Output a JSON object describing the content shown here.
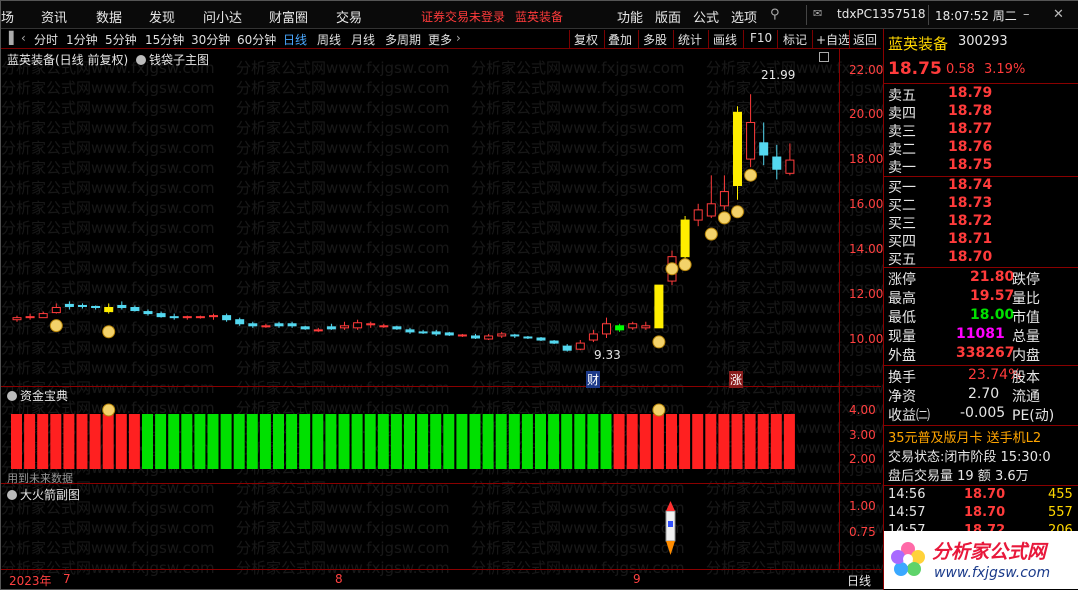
{
  "menubar": {
    "items": [
      "场",
      "资讯",
      "数据",
      "发现",
      "问小达",
      "财富圈",
      "交易"
    ],
    "warning": "证券交易未登录",
    "stock_link": "蓝英装备",
    "right_items": [
      "功能",
      "版面",
      "公式",
      "选项"
    ],
    "user": "tdxPC1357518",
    "clock": "18:07:52 周二"
  },
  "toolbar": {
    "periods": [
      "分时",
      "1分钟",
      "5分钟",
      "15分钟",
      "30分钟",
      "60分钟",
      "日线",
      "周线",
      "月线",
      "多周期",
      "更多"
    ],
    "active_period": "日线",
    "right": [
      "复权",
      "叠加",
      "多股",
      "统计",
      "画线",
      "F10",
      "标记",
      "+自选",
      "返回"
    ]
  },
  "main_panel": {
    "title": "蓝英装备(日线 前复权)",
    "indicator": "钱袋子主图",
    "high_label": "21.99",
    "low_label": "9.33",
    "flag_cai": "财",
    "flag_zhang": "涨"
  },
  "sub1": {
    "title": "资金宝典",
    "note": "用到未来数据"
  },
  "sub2": {
    "title": "大火箭副图"
  },
  "axis": {
    "main": [
      "22.00",
      "20.00",
      "18.00",
      "16.00",
      "14.00",
      "12.00",
      "10.00"
    ],
    "sub1": [
      "4.00",
      "3.00",
      "2.00"
    ],
    "sub2": [
      "1.00",
      "0.75"
    ]
  },
  "dates": {
    "year": "2023年",
    "m7": "7",
    "m8": "8",
    "m9": "9",
    "period_btn": "日线"
  },
  "quote": {
    "name": "蓝英装备",
    "code": "300293",
    "price": "18.75",
    "change": "0.58",
    "pct": "3.19%",
    "asks": [
      {
        "label": "卖五",
        "price": "18.79"
      },
      {
        "label": "卖四",
        "price": "18.78"
      },
      {
        "label": "卖三",
        "price": "18.77"
      },
      {
        "label": "卖二",
        "price": "18.76"
      },
      {
        "label": "卖一",
        "price": "18.75"
      }
    ],
    "bids": [
      {
        "label": "买一",
        "price": "18.74"
      },
      {
        "label": "买二",
        "price": "18.73"
      },
      {
        "label": "买三",
        "price": "18.72"
      },
      {
        "label": "买四",
        "price": "18.71"
      },
      {
        "label": "买五",
        "price": "18.70"
      }
    ],
    "stats": [
      {
        "l1": "涨停",
        "v1": "21.80",
        "l2": "跌停"
      },
      {
        "l1": "最高",
        "v1": "19.57",
        "l2": "量比"
      },
      {
        "l1": "最低",
        "v1": "18.00",
        "l2": "市值"
      },
      {
        "l1": "现量",
        "v1": "11081",
        "l2": "总量"
      },
      {
        "l1": "外盘",
        "v1": "338267",
        "l2": "内盘"
      }
    ],
    "stats2": [
      {
        "l1": "换手",
        "v1": "23.74%",
        "l2": "股本"
      },
      {
        "l1": "净资",
        "v1": "2.70",
        "l2": "流通"
      },
      {
        "l1": "收益㈡",
        "v1": "-0.005",
        "l2": "PE(动)"
      }
    ],
    "promo": "35元普及版月卡 送手机L2",
    "status": "交易状态:闭市阶段 15:30:0",
    "after": "盘后交易量 19 额 3.6万",
    "ticks": [
      {
        "t": "14:56",
        "p": "18.70",
        "v": "455"
      },
      {
        "t": "14:57",
        "p": "18.70",
        "v": "557"
      },
      {
        "t": "14:57",
        "p": "18.72",
        "v": "206"
      }
    ],
    "logo_text": "分析家公式网",
    "logo_url": "www.fxjgsw.com"
  },
  "watermark": "分析家公式网www.fxjgsw.com",
  "colors": {
    "up": "#ff3b3b",
    "down": "#54d8f0",
    "yellow": "#ffee00",
    "green": "#00ff00",
    "red": "#ff2020",
    "grid": "#8a0000"
  }
}
